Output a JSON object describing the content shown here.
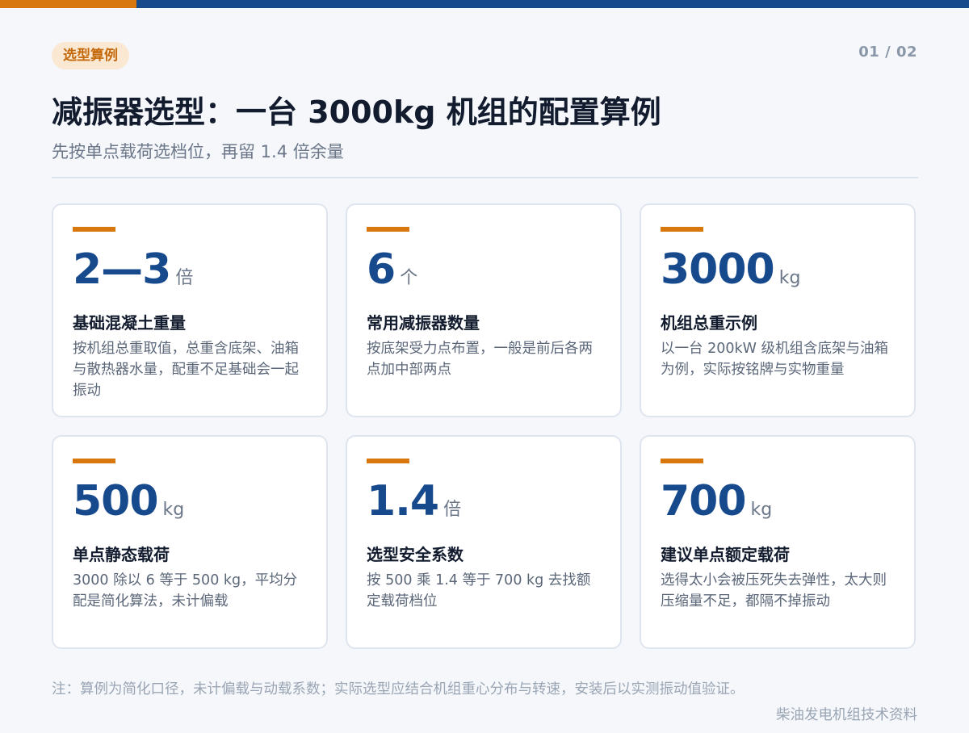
{
  "colors": {
    "accent": "#d9770f",
    "brand": "#174a8c"
  },
  "header": {
    "tag": "选型算例",
    "pager": "01 / 02",
    "title": "减振器选型：一台 3000kg 机组的配置算例",
    "subtitle": "先按单点载荷选档位，再留 1.4 倍余量"
  },
  "cards": [
    {
      "num": "2—3",
      "unit": "倍",
      "label": "基础混凝土重量",
      "desc": "按机组总重取值，总重含底架、油箱与散热器水量，配重不足基础会一起振动"
    },
    {
      "num": "6",
      "unit": "个",
      "label": "常用减振器数量",
      "desc": "按底架受力点布置，一般是前后各两点加中部两点"
    },
    {
      "num": "3000",
      "unit": "kg",
      "label": "机组总重示例",
      "desc": "以一台 200kW 级机组含底架与油箱为例，实际按铭牌与实物重量"
    },
    {
      "num": "500",
      "unit": "kg",
      "label": "单点静态载荷",
      "desc": "3000 除以 6 等于 500 kg，平均分配是简化算法，未计偏载"
    },
    {
      "num": "1.4",
      "unit": "倍",
      "label": "选型安全系数",
      "desc": "按 500 乘 1.4 等于 700 kg 去找额定载荷档位"
    },
    {
      "num": "700",
      "unit": "kg",
      "label": "建议单点额定载荷",
      "desc": "选得太小会被压死失去弹性，太大则压缩量不足，都隔不掉振动"
    }
  ],
  "footer": {
    "note": "注：算例为简化口径，未计偏载与动载系数；实际选型应结合机组重心分布与转速，安装后以实测振动值验证。",
    "source": "柴油发电机组技术资料"
  }
}
